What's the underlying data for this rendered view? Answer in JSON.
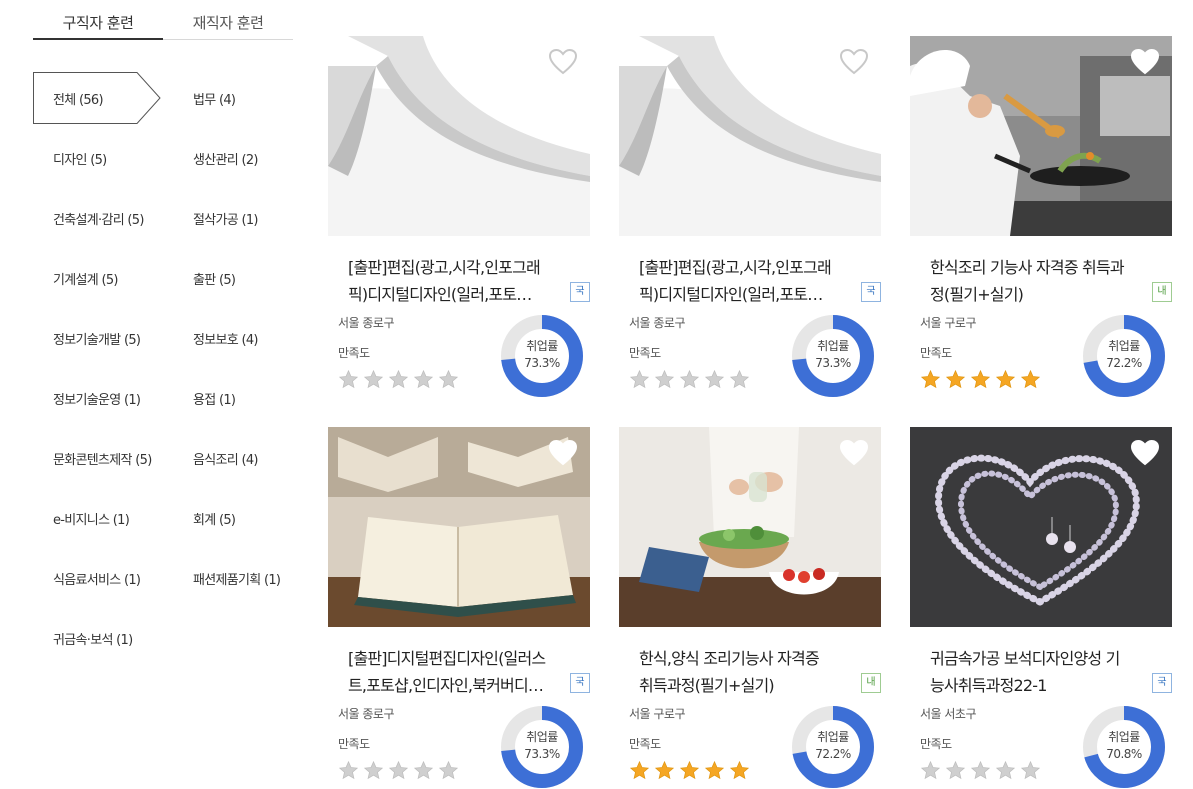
{
  "tabs": [
    {
      "label": "구직자 훈련",
      "active": true
    },
    {
      "label": "재직자 훈련",
      "active": false
    }
  ],
  "categories": [
    {
      "label": "전체 (56)",
      "active": true
    },
    {
      "label": "법무 (4)"
    },
    {
      "label": "디자인 (5)"
    },
    {
      "label": "생산관리 (2)"
    },
    {
      "label": "건축설계·감리 (5)"
    },
    {
      "label": "절삭가공 (1)"
    },
    {
      "label": "기계설계 (5)"
    },
    {
      "label": "출판 (5)"
    },
    {
      "label": "정보기술개발 (5)"
    },
    {
      "label": "정보보호 (4)"
    },
    {
      "label": "정보기술운영 (1)"
    },
    {
      "label": "용접 (1)"
    },
    {
      "label": "문화콘텐츠제작 (5)"
    },
    {
      "label": "음식조리 (4)"
    },
    {
      "label": "e-비지니스 (1)"
    },
    {
      "label": "회계 (5)"
    },
    {
      "label": "식음료서비스 (1)"
    },
    {
      "label": "패션제품기획 (1)"
    },
    {
      "label": "귀금속·보석 (1)"
    }
  ],
  "rate_label": "취업률",
  "satisfaction_label": "만족도",
  "colors": {
    "accent": "#3d6fd6",
    "track": "#e6e6e6",
    "star_on": "#f5a623",
    "star_off": "#cfcfcf",
    "heart": "#cfcfcf"
  },
  "courses": [
    {
      "title_line1": "[출판]편집(광고,시각,인포그래",
      "title_line2": "픽)디지털디자인(일러,포토…",
      "badge": "국",
      "badge_color": "blue",
      "location": "서울 종로구",
      "rating": 0,
      "rate": "73.3%",
      "rate_value": 73.3,
      "image": "paper-icon",
      "liked": false
    },
    {
      "title_line1": "[출판]편집(광고,시각,인포그래",
      "title_line2": "픽)디지털디자인(일러,포토…",
      "badge": "국",
      "badge_color": "blue",
      "location": "서울 종로구",
      "rating": 0,
      "rate": "73.3%",
      "rate_value": 73.3,
      "image": "paper-icon",
      "liked": false
    },
    {
      "title_line1": "한식조리 기능사 자격증 취득과",
      "title_line2": "정(필기+실기)",
      "badge": "내",
      "badge_color": "green",
      "location": "서울 구로구",
      "rating": 5,
      "rate": "72.2%",
      "rate_value": 72.2,
      "image": "chef-icon",
      "liked": false
    },
    {
      "title_line1": "[출판]디지털편집디자인(일러스",
      "title_line2": "트,포토샵,인디자인,북커버디…",
      "badge": "국",
      "badge_color": "blue",
      "location": "서울 종로구",
      "rating": 0,
      "rate": "73.3%",
      "rate_value": 73.3,
      "image": "books-icon",
      "liked": false
    },
    {
      "title_line1": "한식,양식 조리기능사 자격증",
      "title_line2": "취득과정(필기+실기)",
      "badge": "내",
      "badge_color": "green",
      "location": "서울 구로구",
      "rating": 5,
      "rate": "72.2%",
      "rate_value": 72.2,
      "image": "salad-icon",
      "liked": false
    },
    {
      "title_line1": "귀금속가공 보석디자인양성 기",
      "title_line2": "능사취득과정22-1",
      "badge": "국",
      "badge_color": "blue",
      "location": "서울 서초구",
      "rating": 0,
      "rate": "70.8%",
      "rate_value": 70.8,
      "image": "pearl-necklace-icon",
      "liked": false
    }
  ]
}
